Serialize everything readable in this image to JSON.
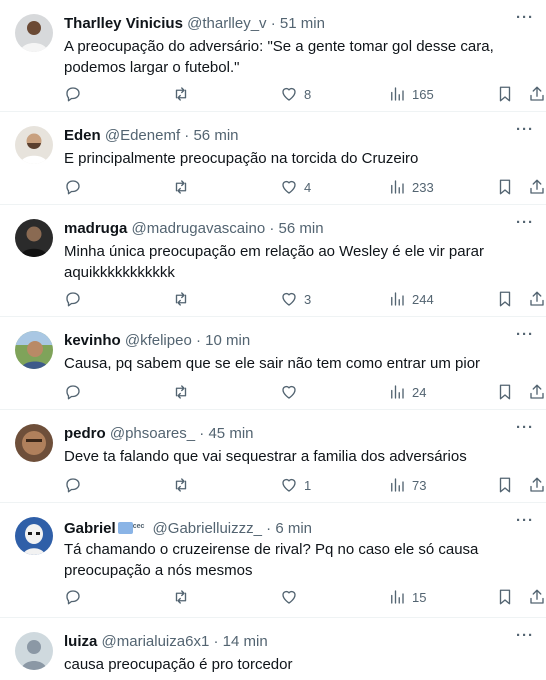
{
  "tweets": [
    {
      "name": "Tharlley Vinicius",
      "handle": "@tharlley_v",
      "time": "51 min",
      "text": "A preocupação do adversário: \"Se a gente tomar gol desse cara, podemos largar o futebol.\"",
      "replies": "",
      "retweets": "",
      "likes": "8",
      "views": "165",
      "avatar": "avatar-man-white-shirt"
    },
    {
      "name": "Eden",
      "handle": "@Edenemf",
      "time": "56 min",
      "text": "E principalmente preocupação na torcida do Cruzeiro",
      "replies": "",
      "retweets": "",
      "likes": "4",
      "views": "233",
      "avatar": "avatar-man-beard"
    },
    {
      "name": "madruga",
      "handle": "@madrugavascaino",
      "time": "56 min",
      "text": "Minha única preocupação em relação ao Wesley é ele vir parar aquikkkkkkkkkkk",
      "replies": "",
      "retweets": "",
      "likes": "3",
      "views": "244",
      "avatar": "avatar-man-dark"
    },
    {
      "name": "kevinho",
      "handle": "@kfelipeo",
      "time": "10 min",
      "text": "Causa, pq sabem que se ele sair não tem como entrar um pior",
      "replies": "",
      "retweets": "",
      "likes": "",
      "views": "24",
      "avatar": "avatar-outdoor"
    },
    {
      "name": "pedro",
      "handle": "@phsoares_",
      "time": "45 min",
      "text": "Deve ta falando que vai sequestrar a familia dos adversários",
      "replies": "",
      "retweets": "",
      "likes": "1",
      "views": "73",
      "avatar": "avatar-man-closeup"
    },
    {
      "name": "Gabriel",
      "name_badge_text": "cec",
      "handle": "@Gabrielluizzz_",
      "time": "6 min",
      "text": "Tá chamando o cruzeirense de rival? Pq no caso ele só causa preocupação a nós mesmos",
      "replies": "",
      "retweets": "",
      "likes": "",
      "views": "15",
      "avatar": "avatar-stormtrooper"
    },
    {
      "name": "luiza",
      "handle": "@marialuiza6x1",
      "time": "14 min",
      "text": "causa preocupação é pro torcedor",
      "avatar": "avatar-default-silhouette"
    }
  ],
  "separator": "·",
  "more_label": "···",
  "colors": {
    "text": "#0f1419",
    "secondary": "#536471",
    "divider": "#eff3f4",
    "badge": "#8ab4e6"
  },
  "icons": [
    "reply-icon",
    "retweet-icon",
    "like-icon",
    "views-icon",
    "bookmark-icon",
    "share-icon",
    "more-icon"
  ]
}
